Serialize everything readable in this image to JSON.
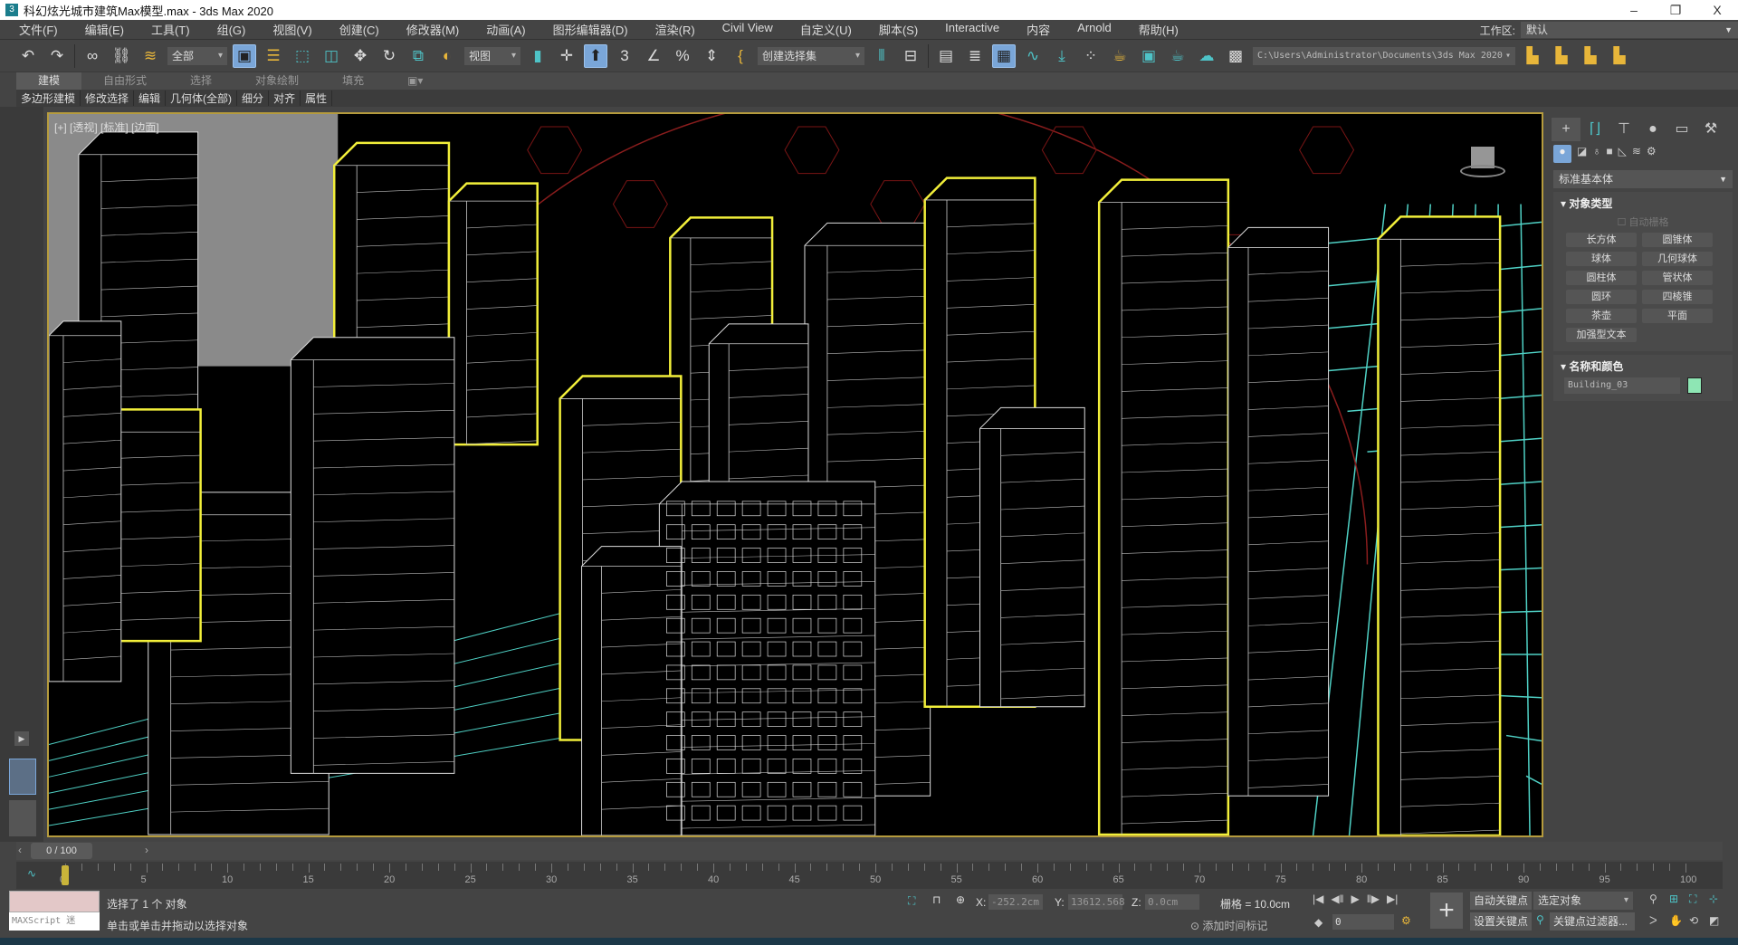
{
  "window": {
    "title": "科幻炫光城市建筑Max模型.max - 3ds Max 2020",
    "app_icon": "3",
    "minimize": "–",
    "restore": "❐",
    "close": "X"
  },
  "menu": [
    "文件(F)",
    "编辑(E)",
    "工具(T)",
    "组(G)",
    "视图(V)",
    "创建(C)",
    "修改器(M)",
    "动画(A)",
    "图形编辑器(D)",
    "渲染(R)",
    "Civil View",
    "自定义(U)",
    "脚本(S)",
    "Interactive",
    "内容",
    "Arnold",
    "帮助(H)"
  ],
  "workspace": {
    "label": "工作区:",
    "value": "默认"
  },
  "toolbar": {
    "selection_filter": "全部",
    "ref_coord": "视图",
    "named_selection": "创建选择集",
    "project_path": "C:\\Users\\Administrator\\Documents\\3ds Max 2020"
  },
  "ribbon": {
    "tabs": [
      "建模",
      "自由形式",
      "选择",
      "对象绘制",
      "填充"
    ],
    "groups": [
      "多边形建模",
      "修改选择",
      "编辑",
      "几何体(全部)",
      "细分",
      "对齐",
      "属性"
    ]
  },
  "viewport": {
    "label": "[+] [透视] [标准] [边面]"
  },
  "command_panel": {
    "category": "标准基本体",
    "object_type_title": "对象类型",
    "autogrid": "自动栅格",
    "buttons": [
      "长方体",
      "圆锥体",
      "球体",
      "几何球体",
      "圆柱体",
      "管状体",
      "圆环",
      "四棱锥",
      "茶壶",
      "平面",
      "加强型文本"
    ],
    "name_color_title": "名称和颜色",
    "object_name": "Building_03",
    "object_color": "#8ee6b4"
  },
  "timeline": {
    "frame": "0 / 100",
    "ticks": [
      "0",
      "5",
      "10",
      "15",
      "20",
      "25",
      "30",
      "35",
      "40",
      "45",
      "50",
      "55",
      "60",
      "65",
      "70",
      "75",
      "80",
      "85",
      "90",
      "95",
      "100"
    ]
  },
  "status": {
    "maxscript": "MAXScript 迷",
    "selected": "选择了 1 个 对象",
    "prompt": "单击或单击并拖动以选择对象",
    "x_label": "X:",
    "x": "-252.2cm",
    "y_label": "Y:",
    "y": "13612.568",
    "z_label": "Z:",
    "z": "0.0cm",
    "grid": "栅格 = 10.0cm",
    "add_time_tag": "添加时间标记",
    "current_frame": "0",
    "auto_key": "自动关键点",
    "set_key": "设置关键点",
    "key_target": "选定对象",
    "key_filters": "关键点过滤器..."
  },
  "colors": {
    "selection": "#f2ef3a",
    "grid": "#4fd1c5",
    "accent": "#7aa6d8"
  }
}
